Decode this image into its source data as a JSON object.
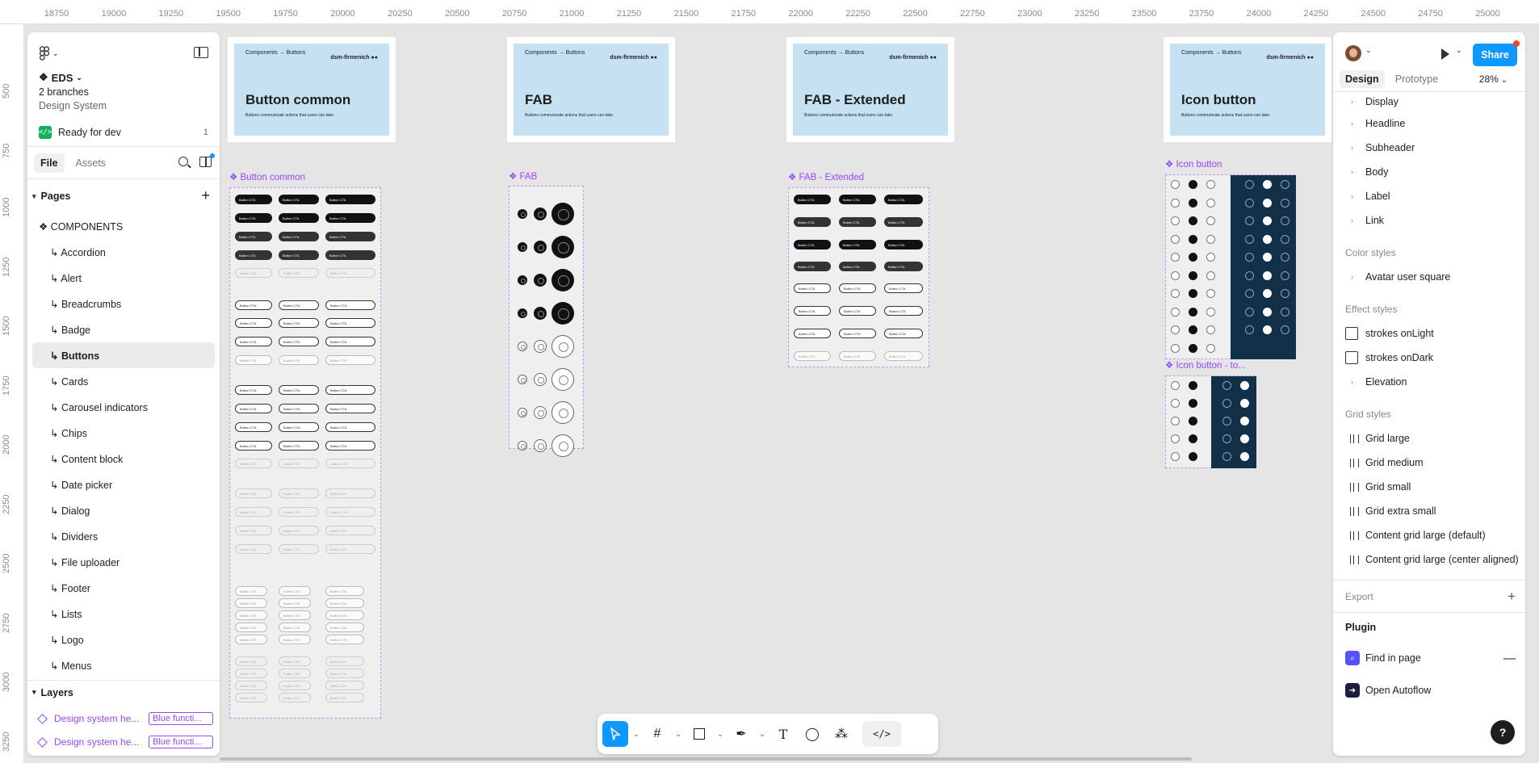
{
  "ruler": {
    "x_ticks": [
      "18750",
      "19000",
      "19250",
      "19500",
      "19750",
      "20000",
      "20250",
      "20500",
      "20750",
      "21000",
      "21250",
      "21500",
      "21750",
      "22000",
      "22250",
      "22500",
      "22750",
      "23000",
      "23250",
      "23500",
      "23750",
      "24000",
      "24250",
      "24500",
      "24750",
      "25000"
    ],
    "y_ticks": [
      "500",
      "750",
      "1000",
      "1250",
      "1500",
      "1750",
      "2000",
      "2250",
      "2500",
      "2750",
      "3000",
      "3250"
    ]
  },
  "left_panel": {
    "project_name": "EDS",
    "branches": "2 branches",
    "team": "Design System",
    "ready_label": "Ready for dev",
    "ready_count": "1",
    "tabs": [
      "File",
      "Assets"
    ],
    "pages_title": "Pages",
    "pages": [
      "❖ COMPONENTS",
      "↳ Accordion",
      "↳ Alert",
      "↳ Breadcrumbs",
      "↳ Badge",
      "↳ Buttons",
      "↳ Cards",
      "↳ Carousel indicators",
      "↳ Chips",
      "↳ Content block",
      "↳ Date picker",
      "↳ Dialog",
      "↳ Dividers",
      "↳ File uploader",
      "↳ Footer",
      "↳ Lists",
      "↳ Logo",
      "↳ Menus"
    ],
    "active_page": 5,
    "layers_title": "Layers",
    "layers": [
      {
        "name": "Design system he...",
        "tag": "Blue functi..."
      },
      {
        "name": "Design system he...",
        "tag": "Blue functi..."
      }
    ]
  },
  "canvas": {
    "covers": [
      {
        "breadcrumb": "Components → Buttons",
        "brand": "dsm-firmenich ●●",
        "title": "Button common",
        "desc": "Buttons communicate actions that users can take."
      },
      {
        "breadcrumb": "Components → Buttons",
        "brand": "dsm-firmenich ●●",
        "title": "FAB",
        "desc": "Buttons communicate actions that users can take."
      },
      {
        "breadcrumb": "Components → Buttons",
        "brand": "dsm-firmenich ●●",
        "title": "FAB - Extended",
        "desc": "Buttons communicate actions that users can take."
      },
      {
        "breadcrumb": "Components → Buttons",
        "brand": "dsm-firmenich ●●",
        "title": "Icon button",
        "desc": "Buttons communicate actions that users can take."
      }
    ],
    "frame_labels": [
      "Button common",
      "FAB",
      "FAB - Extended",
      "Icon button",
      "Icon button - to..."
    ],
    "chip_label": "Button CTA"
  },
  "right_panel": {
    "share_label": "Share",
    "tabs": [
      "Design",
      "Prototype"
    ],
    "zoom": "28%",
    "text_styles": [
      "Display",
      "Headline",
      "Subheader",
      "Body",
      "Label",
      "Link"
    ],
    "color_styles_title": "Color styles",
    "color_styles": [
      "Avatar user square"
    ],
    "effect_styles_title": "Effect styles",
    "effect_styles": [
      "strokes onLight",
      "strokes onDark",
      "Elevation"
    ],
    "grid_styles_title": "Grid styles",
    "grid_styles": [
      "Grid large",
      "Grid medium",
      "Grid small",
      "Grid extra small",
      "Content grid large (default)",
      "Content grid large (center aligned)"
    ],
    "export_label": "Export",
    "plugin_title": "Plugin",
    "plugins": [
      {
        "name": "Find in page",
        "color": "#5551ff"
      },
      {
        "name": "Open Autoflow",
        "color": "#1e1e3f"
      }
    ],
    "help_label": "?"
  },
  "toolbar": {
    "tools": [
      "move-tool",
      "frame-tool",
      "shape-tool",
      "pen-tool",
      "text-tool",
      "comment-tool",
      "actions-tool",
      "dev-mode-toggle"
    ]
  }
}
